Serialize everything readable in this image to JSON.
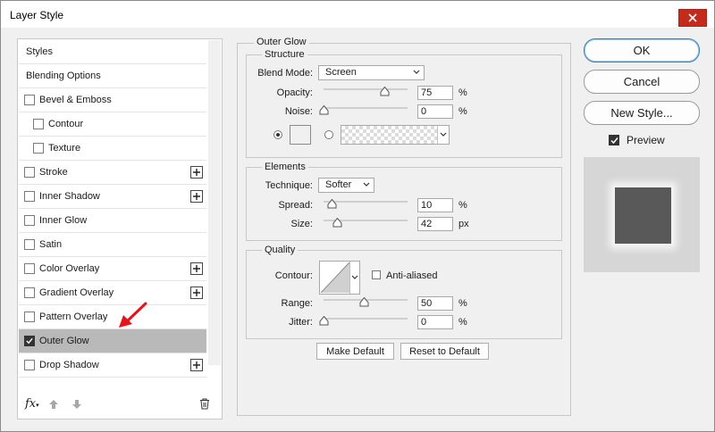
{
  "window": {
    "title": "Layer Style"
  },
  "sidebar": {
    "items": [
      {
        "label": "Styles",
        "checkbox": false,
        "checked": false,
        "plus": false,
        "indent": false,
        "selected": false
      },
      {
        "label": "Blending Options",
        "checkbox": false,
        "checked": false,
        "plus": false,
        "indent": false,
        "selected": false
      },
      {
        "label": "Bevel & Emboss",
        "checkbox": true,
        "checked": false,
        "plus": false,
        "indent": false,
        "selected": false
      },
      {
        "label": "Contour",
        "checkbox": true,
        "checked": false,
        "plus": false,
        "indent": true,
        "selected": false
      },
      {
        "label": "Texture",
        "checkbox": true,
        "checked": false,
        "plus": false,
        "indent": true,
        "selected": false
      },
      {
        "label": "Stroke",
        "checkbox": true,
        "checked": false,
        "plus": true,
        "indent": false,
        "selected": false
      },
      {
        "label": "Inner Shadow",
        "checkbox": true,
        "checked": false,
        "plus": true,
        "indent": false,
        "selected": false
      },
      {
        "label": "Inner Glow",
        "checkbox": true,
        "checked": false,
        "plus": false,
        "indent": false,
        "selected": false
      },
      {
        "label": "Satin",
        "checkbox": true,
        "checked": false,
        "plus": false,
        "indent": false,
        "selected": false
      },
      {
        "label": "Color Overlay",
        "checkbox": true,
        "checked": false,
        "plus": true,
        "indent": false,
        "selected": false
      },
      {
        "label": "Gradient Overlay",
        "checkbox": true,
        "checked": false,
        "plus": true,
        "indent": false,
        "selected": false
      },
      {
        "label": "Pattern Overlay",
        "checkbox": true,
        "checked": false,
        "plus": false,
        "indent": false,
        "selected": false
      },
      {
        "label": "Outer Glow",
        "checkbox": true,
        "checked": true,
        "plus": false,
        "indent": false,
        "selected": true
      },
      {
        "label": "Drop Shadow",
        "checkbox": true,
        "checked": false,
        "plus": true,
        "indent": false,
        "selected": false
      }
    ],
    "footer": {
      "fx_label": "fx"
    }
  },
  "outer_glow": {
    "title": "Outer Glow",
    "structure": {
      "title": "Structure",
      "blend_mode_label": "Blend Mode:",
      "blend_mode_value": "Screen",
      "opacity_label": "Opacity:",
      "opacity_value": "75",
      "opacity_unit": "%",
      "opacity_level": 0.75,
      "noise_label": "Noise:",
      "noise_value": "0",
      "noise_unit": "%",
      "noise_level": 0,
      "color_mode": "solid",
      "glow_color": "#f0f0f0"
    },
    "elements": {
      "title": "Elements",
      "technique_label": "Technique:",
      "technique_value": "Softer",
      "spread_label": "Spread:",
      "spread_value": "10",
      "spread_unit": "%",
      "spread_level": 0.1,
      "size_label": "Size:",
      "size_value": "42",
      "size_unit": "px",
      "size_level": 0.17
    },
    "quality": {
      "title": "Quality",
      "contour_label": "Contour:",
      "anti_aliased_label": "Anti-aliased",
      "anti_aliased_checked": false,
      "range_label": "Range:",
      "range_value": "50",
      "range_unit": "%",
      "range_level": 0.5,
      "jitter_label": "Jitter:",
      "jitter_value": "0",
      "jitter_unit": "%",
      "jitter_level": 0
    },
    "make_default_label": "Make Default",
    "reset_default_label": "Reset to Default"
  },
  "actions": {
    "ok_label": "OK",
    "cancel_label": "Cancel",
    "new_style_label": "New Style...",
    "preview_label": "Preview",
    "preview_checked": true
  },
  "colors": {
    "selected_row": "#b9b9b9",
    "close_button": "#c42b1c",
    "preview_swatch": "#595959",
    "preview_bg": "#d6d6d6",
    "annotation_arrow": "#e8121a"
  },
  "icons": [
    "close-icon",
    "plus-icon",
    "fx-icon",
    "move-up-icon",
    "move-down-icon",
    "trash-icon",
    "dropdown-caret-icon",
    "slider-thumb-icon",
    "annotation-arrow-icon"
  ]
}
